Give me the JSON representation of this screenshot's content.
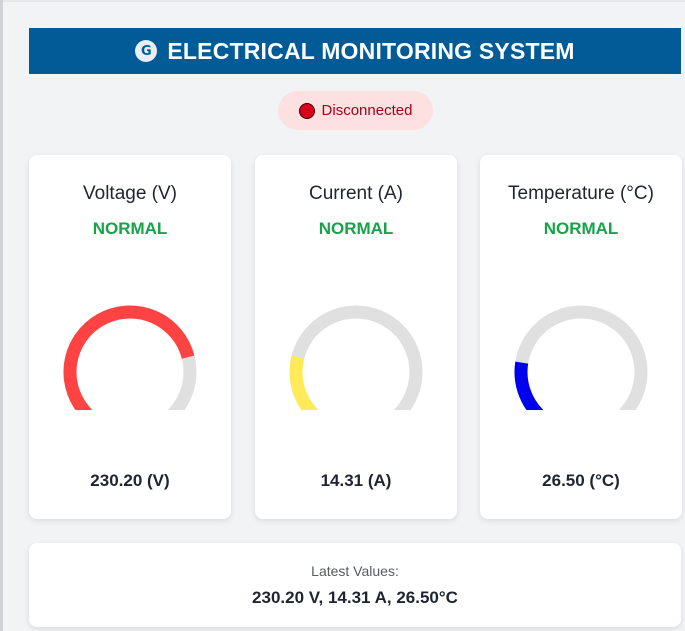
{
  "header": {
    "logo_letter": "G",
    "title": "ELECTRICAL MONITORING SYSTEM"
  },
  "connection": {
    "status": "Disconnected",
    "color": "#d9001b"
  },
  "gauges": [
    {
      "label": "Voltage (V)",
      "state": "NORMAL",
      "value_text": "230.20 (V)",
      "fill_fraction": 0.78,
      "color": "#ff4343",
      "track_color": "#e0e0e0"
    },
    {
      "label": "Current (A)",
      "state": "NORMAL",
      "value_text": "14.31 (A)",
      "fill_fraction": 0.22,
      "color": "#ffeb5a",
      "track_color": "#e0e0e0"
    },
    {
      "label": "Temperature (°C)",
      "state": "NORMAL",
      "value_text": "26.50 (°C)",
      "fill_fraction": 0.2,
      "color": "#0000ee",
      "track_color": "#e0e0e0"
    }
  ],
  "latest": {
    "caption": "Latest Values:",
    "values": "230.20 V, 14.31 A, 26.50°C"
  },
  "colors": {
    "header_bg": "#005b96",
    "normal_status": "#16a34a",
    "pill_bg": "#fde1e1"
  }
}
